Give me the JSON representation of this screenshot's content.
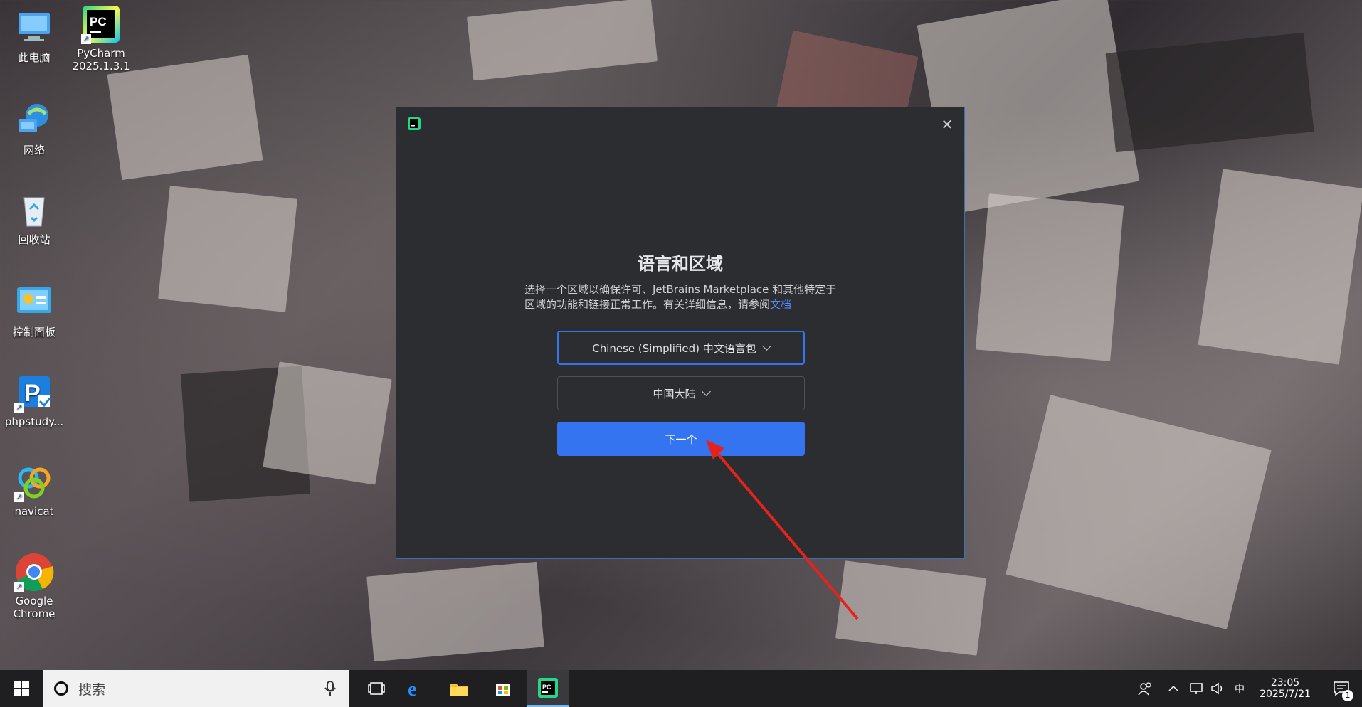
{
  "desktop": {
    "icons": [
      {
        "label": "此电脑",
        "icon": "computer-icon"
      },
      {
        "label": "PyCharm\n2025.1.3.1",
        "icon": "pycharm-icon"
      },
      {
        "label": "网络",
        "icon": "network-icon"
      },
      {
        "label": "回收站",
        "icon": "recycle-bin-icon"
      },
      {
        "label": "控制面板",
        "icon": "control-panel-icon"
      },
      {
        "label": "phpstudy...",
        "icon": "phpstudy-icon"
      },
      {
        "label": "navicat",
        "icon": "navicat-icon"
      },
      {
        "label": "Google\nChrome",
        "icon": "chrome-icon"
      }
    ]
  },
  "dialog": {
    "close_label": "✕",
    "title": "语言和区域",
    "desc_line1": "选择一个区域以确保许可、JetBrains Marketplace 和其他特定于",
    "desc_line2": "区域的功能和链接正常工作。有关详细信息，请参阅",
    "desc_link": "文档",
    "language_value": "Chinese (Simplified) 中文语言包",
    "region_value": "中国大陆",
    "next_label": "下一个",
    "accent_color": "#3574f0"
  },
  "taskbar": {
    "search_placeholder": "搜索",
    "ime": "中",
    "time": "23:05",
    "date": "2025/7/21",
    "notification_count": "1"
  }
}
